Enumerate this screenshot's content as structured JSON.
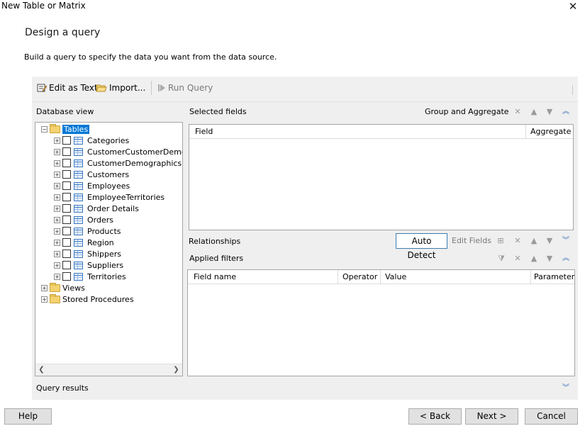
{
  "window": {
    "title": "New Table or Matrix",
    "close_glyph": "✕"
  },
  "header": {
    "heading": "Design a query",
    "subtitle": "Build a query to specify the data you want from the data source."
  },
  "toolbar": {
    "edit_as_text": "Edit as Text",
    "import": "Import...",
    "run_query": "Run Query"
  },
  "database_view": {
    "label": "Database view",
    "tables_label": "Tables",
    "tables": [
      "Categories",
      "CustomerCustomerDemo",
      "CustomerDemographics",
      "Customers",
      "Employees",
      "EmployeeTerritories",
      "Order Details",
      "Orders",
      "Products",
      "Region",
      "Shippers",
      "Suppliers",
      "Territories"
    ],
    "views_label": "Views",
    "stored_procedures_label": "Stored Procedures"
  },
  "selected_fields": {
    "label": "Selected fields",
    "group_and_aggregate": "Group and Aggregate",
    "columns": [
      "Field",
      "Aggregate"
    ]
  },
  "relationships": {
    "label": "Relationships",
    "auto_detect": "Auto Detect",
    "edit_fields": "Edit Fields"
  },
  "applied_filters": {
    "label": "Applied filters",
    "columns": [
      "Field name",
      "Operator",
      "Value",
      "Parameter"
    ]
  },
  "query_results": {
    "label": "Query results"
  },
  "footer": {
    "help": "Help",
    "back": "< Back",
    "next": "Next >",
    "cancel": "Cancel"
  }
}
